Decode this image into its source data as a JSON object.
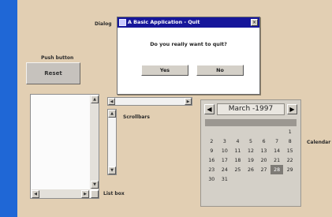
{
  "dialog": {
    "caption_label": "Dialog",
    "title": "A Basic Application - Quit",
    "prompt": "Do you really want to quit?",
    "yes_label": "Yes",
    "no_label": "No"
  },
  "push_button": {
    "caption_label": "Push button",
    "label": "Reset"
  },
  "scrollbars": {
    "caption_label": "Scrollbars"
  },
  "listbox": {
    "caption_label": "List box"
  },
  "calendar": {
    "caption_label": "Calendar",
    "month_label": "March -1997",
    "weeks": [
      [
        "",
        "",
        "",
        "",
        "",
        "",
        "1"
      ],
      [
        "2",
        "3",
        "4",
        "5",
        "6",
        "7",
        "8"
      ],
      [
        "9",
        "10",
        "11",
        "12",
        "13",
        "14",
        "15"
      ],
      [
        "16",
        "17",
        "18",
        "19",
        "20",
        "21",
        "22"
      ],
      [
        "23",
        "24",
        "25",
        "26",
        "27",
        "28",
        "29"
      ],
      [
        "30",
        "31",
        "",
        "",
        "",
        "",
        ""
      ]
    ],
    "selected_day": "28"
  },
  "colors": {
    "background": "#e2cfb3",
    "left_strip": "#1f67d6",
    "titlebar": "#16169a"
  }
}
